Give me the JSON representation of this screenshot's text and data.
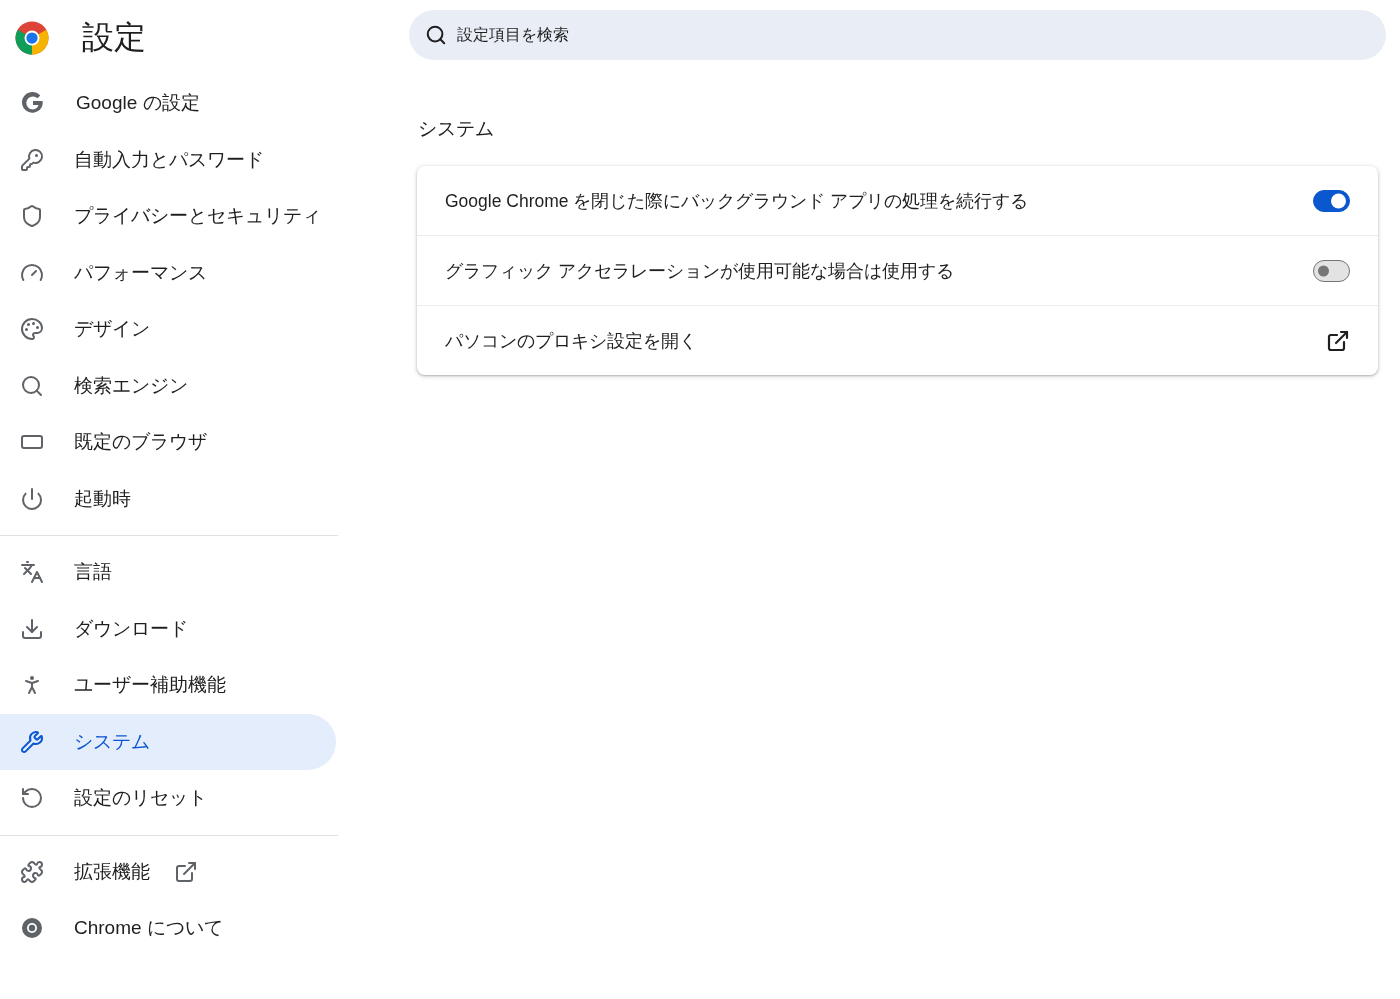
{
  "header": {
    "title": "設定"
  },
  "search": {
    "placeholder": "設定項目を検索"
  },
  "sidebar": {
    "groups": [
      [
        {
          "label": "Google の設定",
          "selected": false,
          "external": false
        },
        {
          "label": "自動入力とパスワード",
          "selected": false,
          "external": false
        },
        {
          "label": "プライバシーとセキュリティ",
          "selected": false,
          "external": false
        },
        {
          "label": "パフォーマンス",
          "selected": false,
          "external": false
        },
        {
          "label": "デザイン",
          "selected": false,
          "external": false
        },
        {
          "label": "検索エンジン",
          "selected": false,
          "external": false
        },
        {
          "label": "既定のブラウザ",
          "selected": false,
          "external": false
        },
        {
          "label": "起動時",
          "selected": false,
          "external": false
        }
      ],
      [
        {
          "label": "言語",
          "selected": false,
          "external": false
        },
        {
          "label": "ダウンロード",
          "selected": false,
          "external": false
        },
        {
          "label": "ユーザー補助機能",
          "selected": false,
          "external": false
        },
        {
          "label": "システム",
          "selected": true,
          "external": false
        },
        {
          "label": "設定のリセット",
          "selected": false,
          "external": false
        }
      ],
      [
        {
          "label": "拡張機能",
          "selected": false,
          "external": true
        },
        {
          "label": "Chrome について",
          "selected": false,
          "external": false
        }
      ]
    ]
  },
  "section": {
    "title": "システム",
    "rows": [
      {
        "kind": "toggle",
        "label": "Google Chrome を閉じた際にバックグラウンド アプリの処理を続行する",
        "on": true
      },
      {
        "kind": "toggle",
        "label": "グラフィック アクセラレーションが使用可能な場合は使用する",
        "on": false
      },
      {
        "kind": "link",
        "label": "パソコンのプロキシ設定を開く"
      }
    ]
  }
}
